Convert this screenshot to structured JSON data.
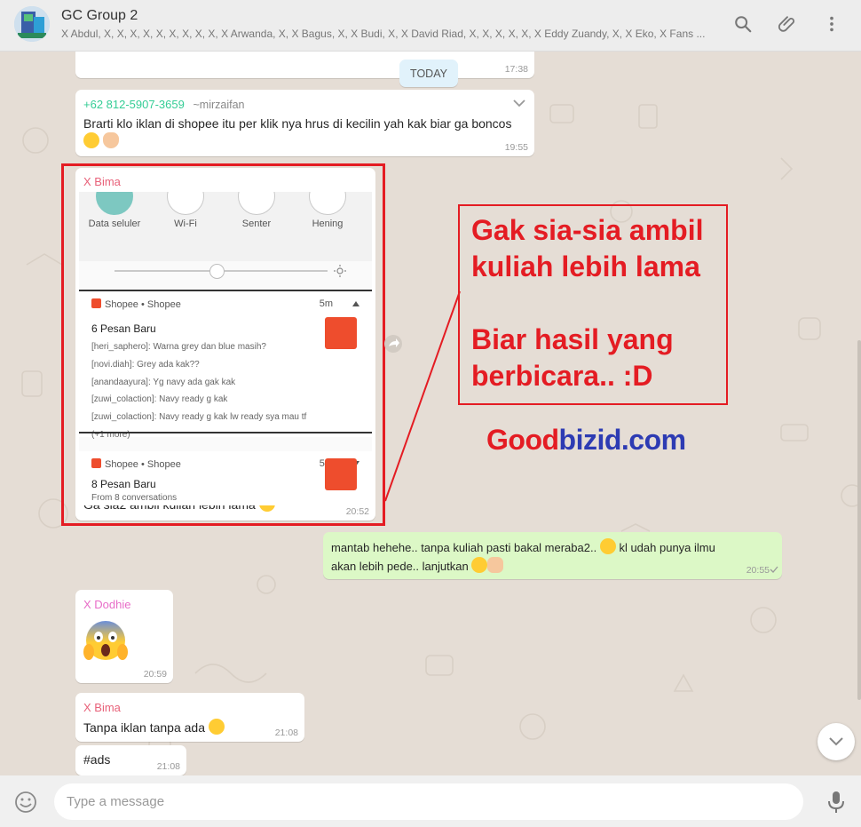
{
  "header": {
    "title": "GC Group 2",
    "members": "X Abdul, X, X, X, X, X, X, X, X, X, X Arwanda, X, X Bagus, X, X Budi, X, X David Riad, X, X, X, X, X, X Eddy Zuandy, X, X Eko, X Fans ..."
  },
  "date_divider": {
    "label": "TODAY",
    "prev_time": "17:38"
  },
  "messages": [
    {
      "phone": "+62 812-5907-3659",
      "nickname": "~mirzaifan",
      "line1": "Brarti klo iklan di shopee itu per klik nya hrus di kecilin yah kak biar ga boncos",
      "time": "19:55"
    },
    {
      "sender": "X Bima",
      "caption": "Ga sia2 ambil kuliah lebih lama",
      "time": "20:52",
      "screenshot": {
        "quick_settings": [
          "Data seluler",
          "Wi-Fi",
          "Senter",
          "Hening"
        ],
        "notif1": {
          "app": "Shopee • Shopee",
          "time": "5m",
          "title": "6 Pesan Baru",
          "lines": [
            "[heri_saphero]: Warna grey dan blue masih?",
            "[novi.diah]: Grey ada kak??",
            "[anandaayura]: Yg navy ada gak kak",
            "[zuwi_colaction]: Navy ready g kak",
            "[zuwi_colaction]: Navy ready g kak lw ready sya mau tf",
            "(+1 more)"
          ]
        },
        "notif2": {
          "app": "Shopee • Shopee",
          "time": "5m",
          "title": "8 Pesan Baru",
          "subtitle": "From 8 conversations"
        }
      }
    },
    {
      "outgoing": true,
      "line1": "mantab hehehe.. tanpa kuliah pasti bakal meraba2..",
      "line1b": "kl udah punya ilmu",
      "line2": "akan lebih pede.. lanjutkan",
      "time": "20:55"
    },
    {
      "sender": "X Dodhie",
      "time": "20:59"
    },
    {
      "sender": "X Bima",
      "text": "Tanpa iklan tanpa ada",
      "time": "21:08"
    },
    {
      "text": "#ads",
      "time": "21:08"
    }
  ],
  "annotation": {
    "line1": "Gak sia-sia ambil",
    "line2": "kuliah lebih lama",
    "line3": "Biar hasil yang",
    "line4": "berbicara.. :D"
  },
  "watermark": {
    "part1": "Good",
    "part2": "bizid.com"
  },
  "composer": {
    "placeholder": "Type a message"
  },
  "colors": {
    "accent_red": "#e41c23",
    "sender_bima": "#e8627a",
    "sender_dodhie": "#e86dc8",
    "phone_teal": "#35cd96",
    "watermark_red": "#e41c23",
    "watermark_blue": "#2d3bb3",
    "outgoing_bubble": "#dcf8c6"
  }
}
